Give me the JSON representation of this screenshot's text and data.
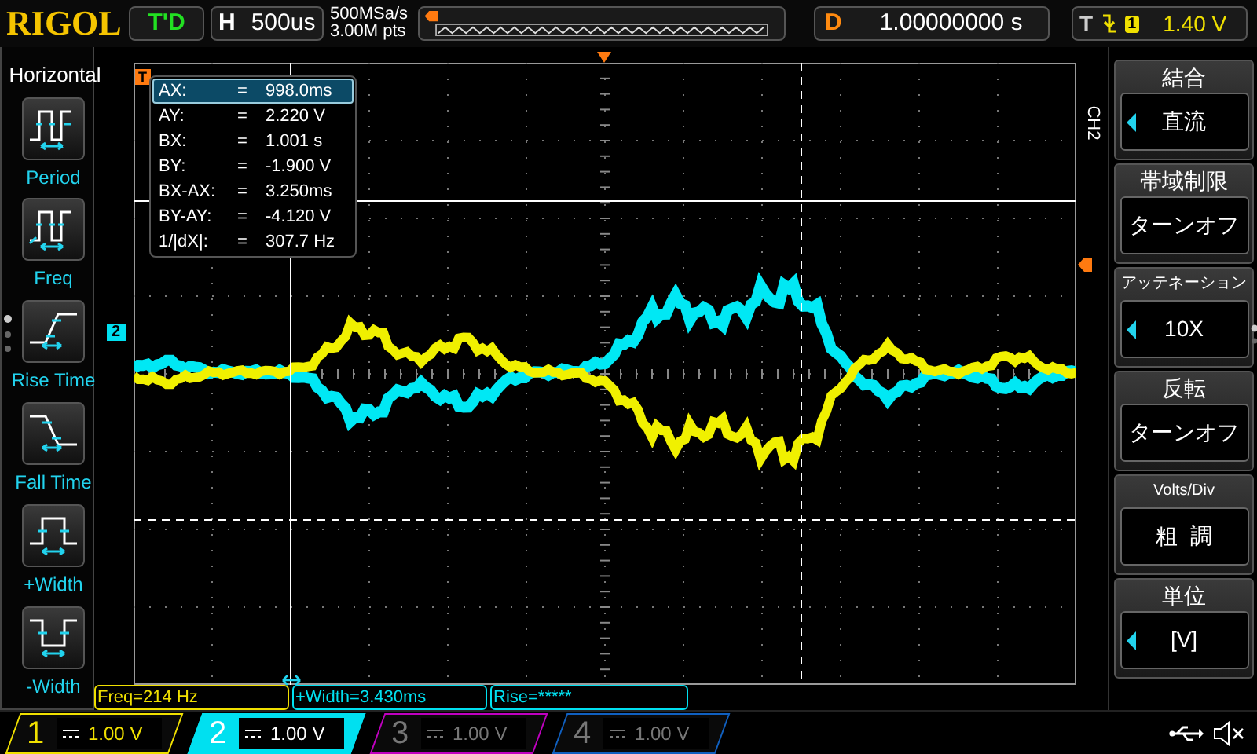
{
  "brand": "RIGOL",
  "run_status": "T'D",
  "timebase": {
    "label": "H",
    "value": "500us"
  },
  "sample_rate": "500MSa/s",
  "memory_depth": "3.00M pts",
  "delay": {
    "label": "D",
    "value": "1.00000000 s"
  },
  "trigger": {
    "label": "T",
    "source": "1",
    "level": "1.40 V"
  },
  "sidebar": {
    "title": "Horizontal",
    "items": [
      {
        "label": "Period",
        "kind": "period"
      },
      {
        "label": "Freq",
        "kind": "freq"
      },
      {
        "label": "Rise Time",
        "kind": "rise"
      },
      {
        "label": "Fall Time",
        "kind": "fall"
      },
      {
        "label": "+Width",
        "kind": "pwidth"
      },
      {
        "label": "-Width",
        "kind": "nwidth"
      }
    ]
  },
  "grid": {
    "trigger_marker": "T",
    "channel_marker": "2",
    "cursor_readout": [
      {
        "name": "AX:",
        "eq": "=",
        "value": "998.0ms",
        "selected": true
      },
      {
        "name": "AY:",
        "eq": "=",
        "value": "2.220 V",
        "selected": false
      },
      {
        "name": "BX:",
        "eq": "=",
        "value": "1.001 s",
        "selected": false
      },
      {
        "name": "BY:",
        "eq": "=",
        "value": "-1.900 V",
        "selected": false
      },
      {
        "name": "BX-AX:",
        "eq": "=",
        "value": "3.250ms",
        "selected": false
      },
      {
        "name": "BY-AY:",
        "eq": "=",
        "value": "-4.120 V",
        "selected": false
      },
      {
        "name": "1/|dX|:",
        "eq": "=",
        "value": "307.7 Hz",
        "selected": false
      }
    ]
  },
  "menu": {
    "channel": "CH2",
    "items": [
      {
        "title": "結合",
        "value": "直流",
        "arrow": true
      },
      {
        "title": "帯域制限",
        "value": "ターンオフ",
        "arrow": false
      },
      {
        "title": "アッテネーション",
        "value": "10X",
        "arrow": true
      },
      {
        "title": "反転",
        "value": "ターンオフ",
        "arrow": false
      },
      {
        "title": "Volts/Div",
        "value": "粗  調",
        "arrow": false
      },
      {
        "title": "単位",
        "value": "[V]",
        "arrow": true
      }
    ]
  },
  "measurements": [
    {
      "text": "Freq=214 Hz",
      "color": "#f0e000"
    },
    {
      "text": "+Width=3.430ms",
      "color": "#00e0f0"
    },
    {
      "text": "Rise=*****",
      "color": "#00e0f0"
    }
  ],
  "channels": [
    {
      "number": "1",
      "scale": "1.00 V",
      "on": true,
      "selected": false,
      "color": "#f0e000"
    },
    {
      "number": "2",
      "scale": "1.00 V",
      "on": true,
      "selected": true,
      "color": "#00e0f0"
    },
    {
      "number": "3",
      "scale": "1.00 V",
      "on": false,
      "selected": false,
      "color": "#c000c0"
    },
    {
      "number": "4",
      "scale": "1.00 V",
      "on": false,
      "selected": false,
      "color": "#1060c0"
    }
  ]
}
